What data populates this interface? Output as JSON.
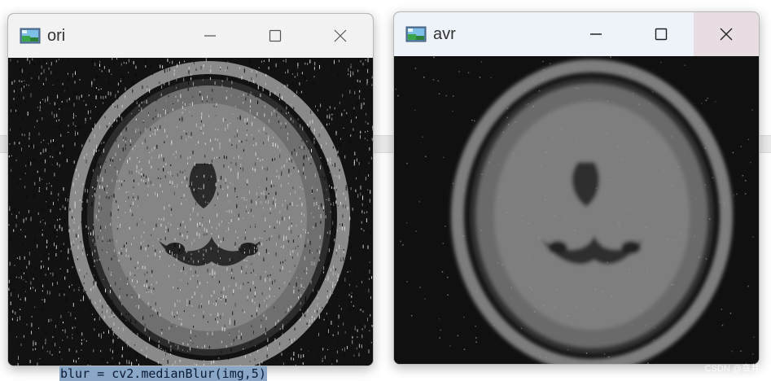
{
  "background": {
    "code_text": "blur = cv2.medianBlur(img,5)",
    "watermark": "CSDN @章井"
  },
  "windows": [
    {
      "id": "ori",
      "title": "ori",
      "icon": "app-image-icon",
      "controls": [
        "minimize-icon",
        "maximize-icon",
        "close-icon"
      ],
      "image": "noisy brain MRI with salt-and-pepper noise"
    },
    {
      "id": "avr",
      "title": "avr",
      "icon": "app-image-icon",
      "controls": [
        "minimize-icon",
        "maximize-icon",
        "close-icon"
      ],
      "image": "brain MRI after median blur"
    }
  ],
  "colors": {
    "titlebar_inactive": "#f2f2f2",
    "titlebar_active": "#eef3fa",
    "close_hover": "#e8dde2",
    "code_highlight": "#8aa7c8"
  }
}
